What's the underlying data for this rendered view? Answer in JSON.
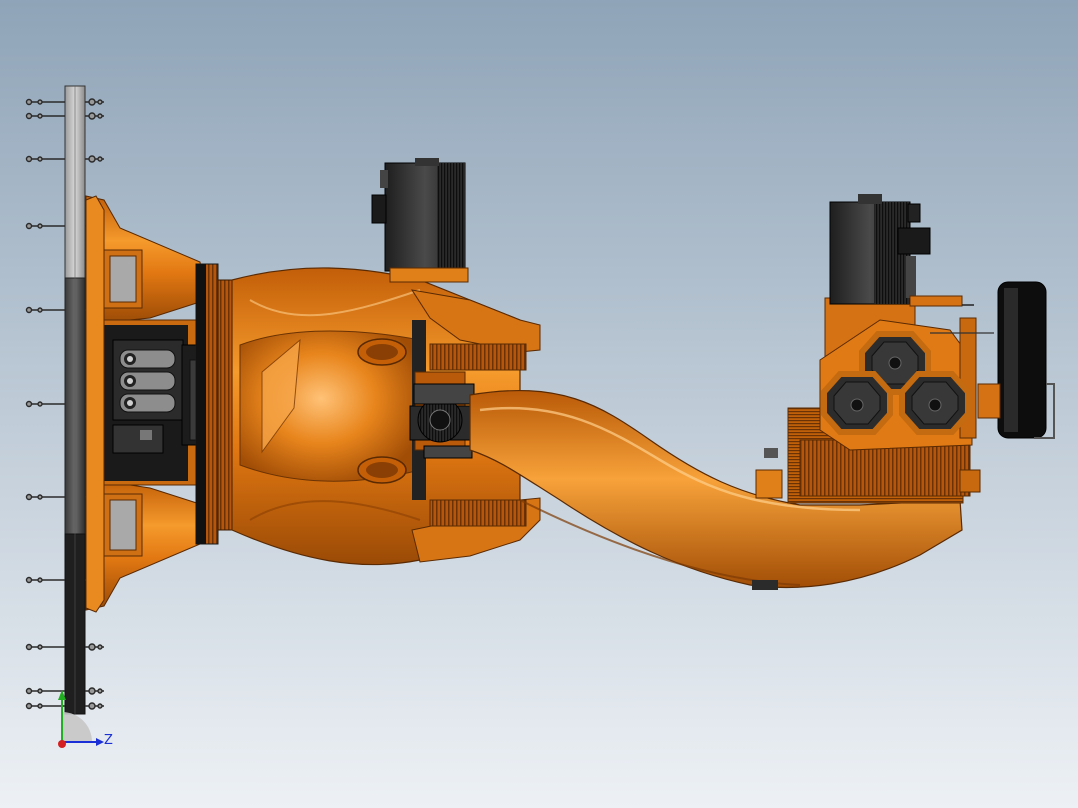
{
  "viewport": {
    "background_top": "#8fa4b8",
    "background_bottom": "#ecf0f4",
    "model_primary_color": "#e07a12",
    "model_dark_color": "#3a3a3a"
  },
  "triad": {
    "x_axis_color": "#d42020",
    "y_axis_color": "#22b022",
    "z_axis_color": "#1b2fd6",
    "z_label": "Z",
    "icon": "coordinate-triad-icon"
  }
}
